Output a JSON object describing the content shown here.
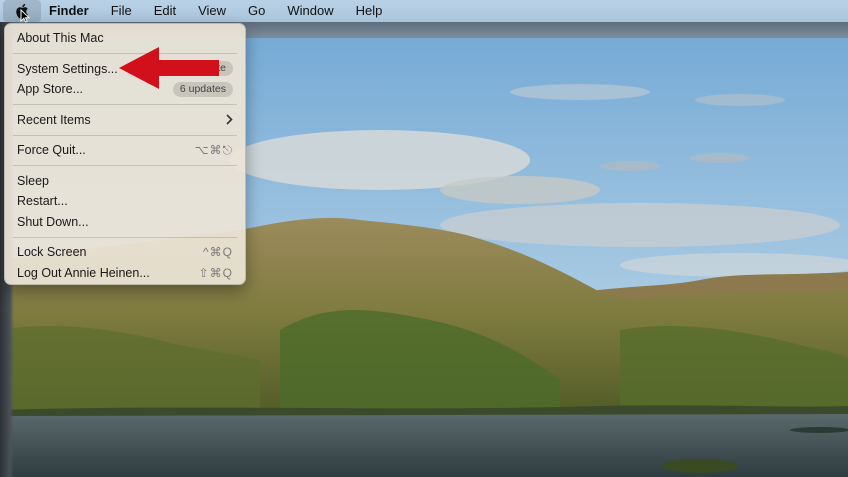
{
  "menubar": {
    "apple_icon": "apple-logo-icon",
    "items": [
      "Finder",
      "File",
      "Edit",
      "View",
      "Go",
      "Window",
      "Help"
    ]
  },
  "apple_menu": {
    "about": "About This Mac",
    "system_settings": "System Settings...",
    "system_settings_badge": "1 update",
    "app_store": "App Store...",
    "app_store_badge": "6 updates",
    "recent_items": "Recent Items",
    "recent_items_icon": "chevron-right-icon",
    "force_quit": "Force Quit...",
    "force_quit_shortcut": "⌥⌘⎋",
    "sleep": "Sleep",
    "restart": "Restart...",
    "shut_down": "Shut Down...",
    "lock_screen": "Lock Screen",
    "lock_screen_shortcut": "^⌘Q",
    "log_out": "Log Out Annie Heinen...",
    "log_out_shortcut": "⇧⌘Q"
  },
  "annotation": {
    "arrow_icon": "red-arrow-icon",
    "arrow_color": "#d2101c"
  }
}
